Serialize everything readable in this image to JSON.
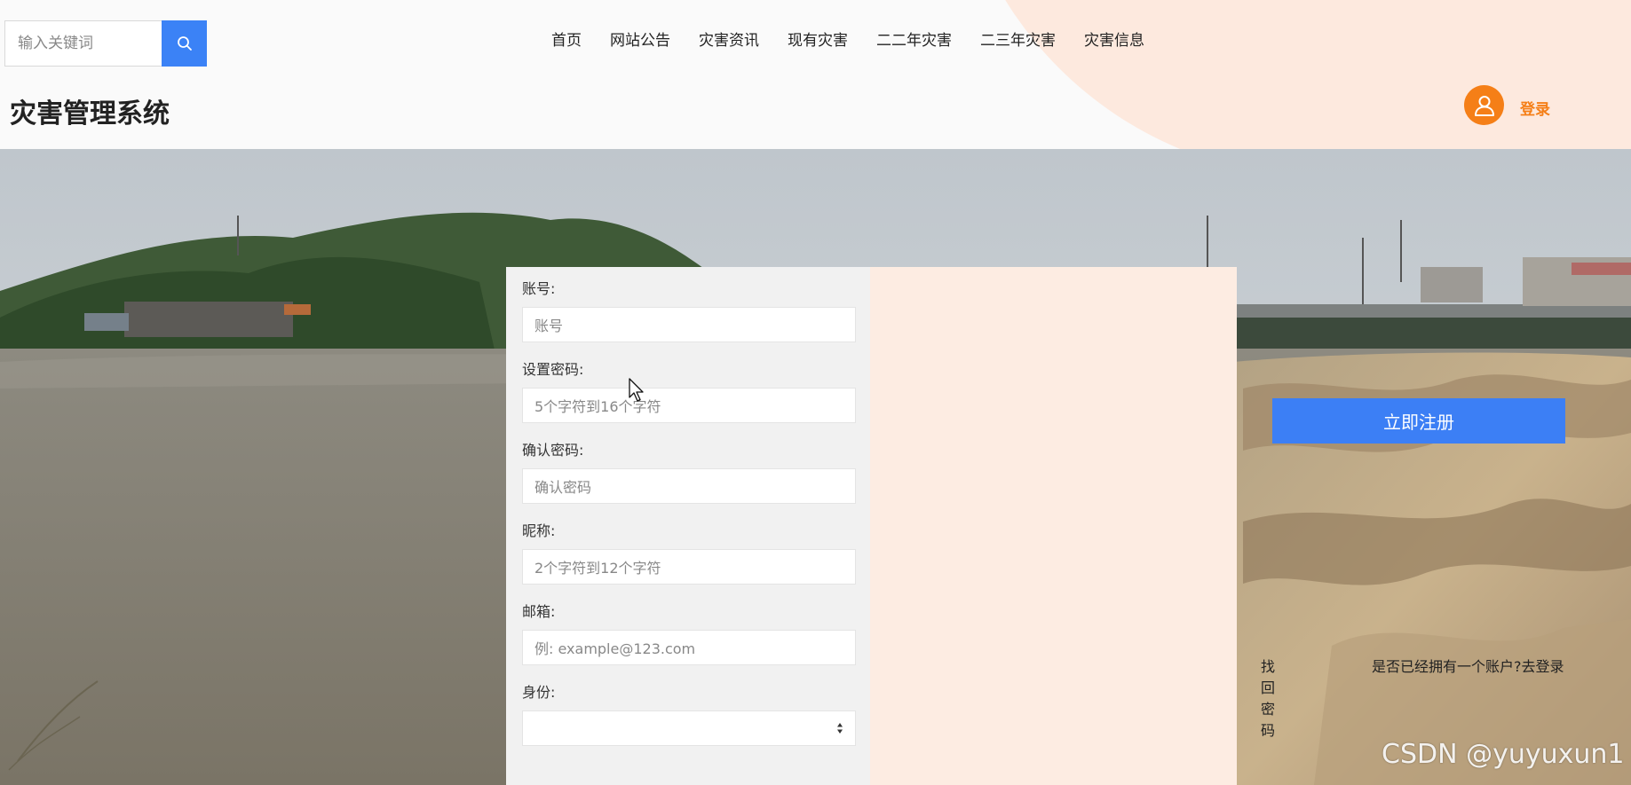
{
  "header": {
    "search_placeholder": "输入关键词",
    "site_title": "灾害管理系统",
    "login_label": "登录"
  },
  "nav": {
    "items": [
      "首页",
      "网站公告",
      "灾害资讯",
      "现有灾害",
      "二二年灾害",
      "二三年灾害",
      "灾害信息"
    ]
  },
  "form": {
    "account_label": "账号:",
    "account_placeholder": "账号",
    "password_label": "设置密码:",
    "password_placeholder": "5个字符到16个字符",
    "confirm_label": "确认密码:",
    "confirm_placeholder": "确认密码",
    "nickname_label": "昵称:",
    "nickname_placeholder": "2个字符到12个字符",
    "email_label": "邮箱:",
    "email_placeholder": "例: example@123.com",
    "role_label": "身份:",
    "role_value": "",
    "submit_label": "立即注册",
    "forgot_link": "找回密码",
    "login_link": "是否已经拥有一个账户?去登录"
  },
  "watermark": "CSDN @yuyuxun1",
  "colors": {
    "accent_blue": "#3c7ff5",
    "accent_orange": "#f57f17",
    "header_blob": "#fde9de"
  }
}
